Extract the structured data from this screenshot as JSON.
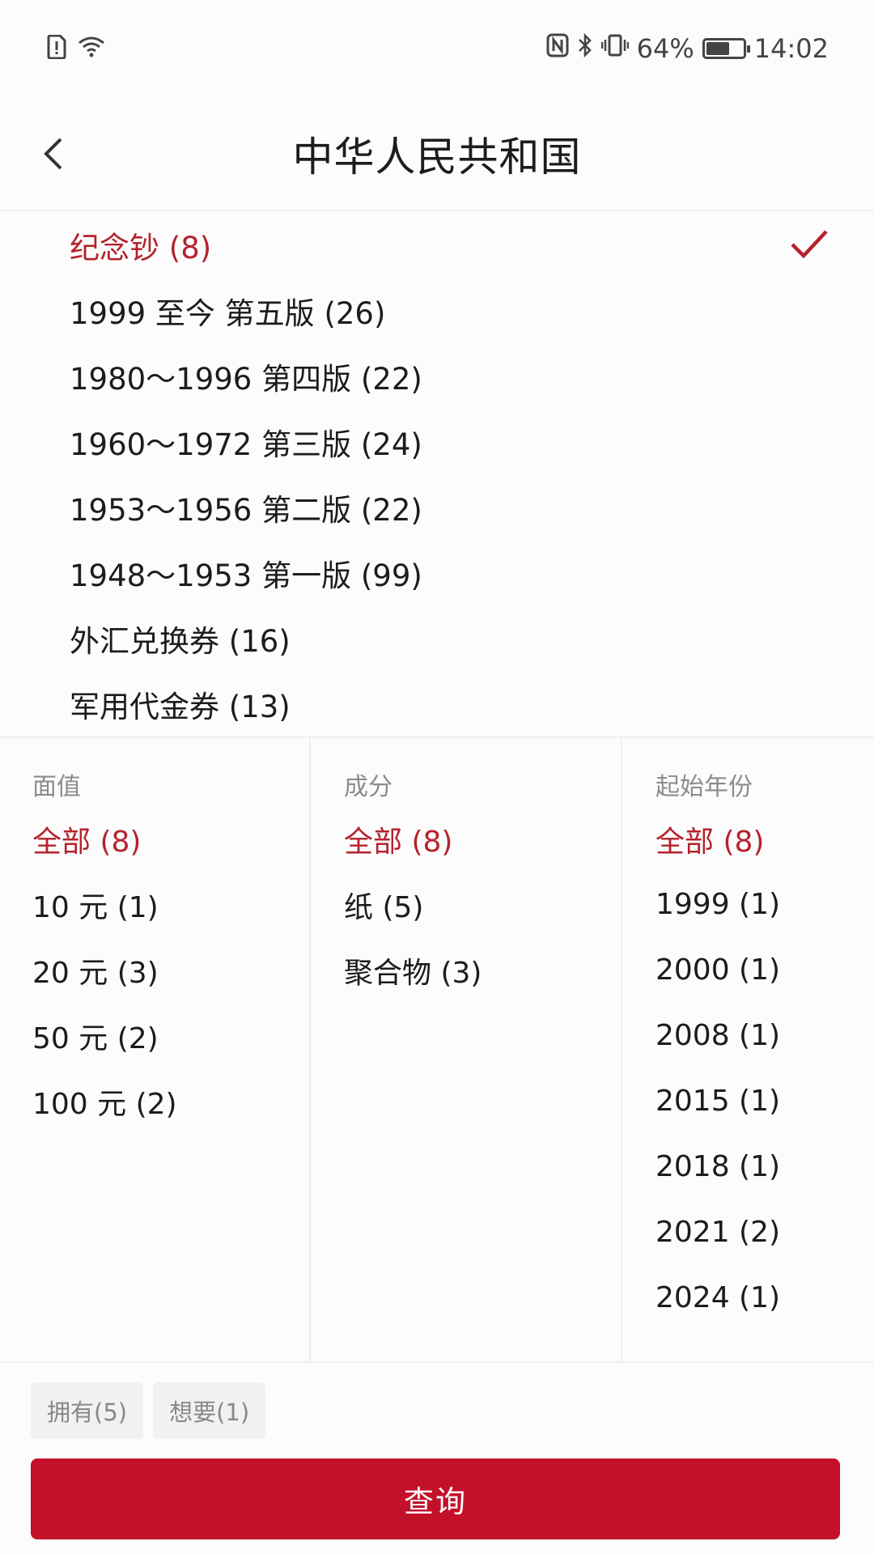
{
  "status_bar": {
    "battery_text": "64%",
    "battery_level": 0.64,
    "time": "14:02",
    "left_icons": [
      "sim-alert-icon",
      "wifi-icon"
    ],
    "right_icons": [
      "nfc-icon",
      "bluetooth-icon",
      "vibrate-icon",
      "battery-icon"
    ]
  },
  "nav": {
    "title": "中华人民共和国",
    "back_icon": "chevron-left-icon"
  },
  "categories": [
    {
      "label": "纪念钞 (8)",
      "selected": true
    },
    {
      "label": "1999 至今 第五版 (26)",
      "selected": false
    },
    {
      "label": "1980～1996 第四版 (22)",
      "selected": false
    },
    {
      "label": "1960～1972 第三版 (24)",
      "selected": false
    },
    {
      "label": "1953～1956 第二版 (22)",
      "selected": false
    },
    {
      "label": "1948～1953 第一版 (99)",
      "selected": false
    },
    {
      "label": "外汇兑换券 (16)",
      "selected": false
    },
    {
      "label": "军用代金券 (13)",
      "selected": false
    }
  ],
  "filters": {
    "denomination": {
      "header": "面值",
      "options": [
        "全部 (8)",
        "10 元 (1)",
        "20 元 (3)",
        "50 元 (2)",
        "100 元 (2)"
      ]
    },
    "material": {
      "header": "成分",
      "options": [
        "全部 (8)",
        "纸 (5)",
        "聚合物 (3)"
      ]
    },
    "start_year": {
      "header": "起始年份",
      "options": [
        "全部 (8)",
        "1999 (1)",
        "2000 (1)",
        "2008 (1)",
        "2015 (1)",
        "2018 (1)",
        "2021 (2)",
        "2024 (1)"
      ]
    }
  },
  "tags": {
    "owned": "拥有(5)",
    "wanted": "想要(1)"
  },
  "query_button": "查询",
  "colors": {
    "accent": "#b5222d",
    "button": "#c4112a"
  }
}
